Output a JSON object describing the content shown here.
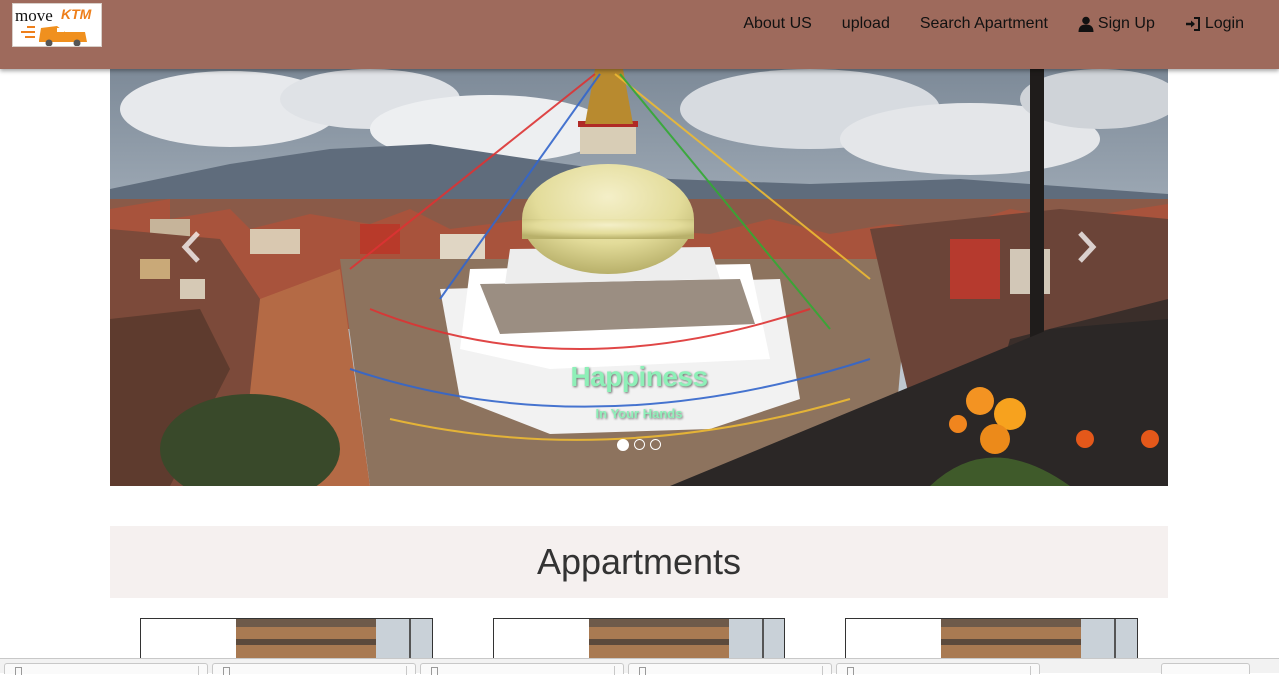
{
  "brand": {
    "logo_text_a": "move",
    "logo_text_b": "KTM"
  },
  "nav": {
    "about": "About US",
    "upload": "upload",
    "search": "Search Apartment",
    "signup": "Sign Up",
    "login": "Login"
  },
  "icons": {
    "signup": "user-icon",
    "login": "login-icon",
    "prev": "chevron-left-icon",
    "next": "chevron-right-icon"
  },
  "carousel": {
    "caption_title": "Happiness",
    "caption_subtitle": "In Your Hands",
    "slide_count": 3,
    "active_slide": 1
  },
  "section": {
    "title": "Appartments"
  },
  "colors": {
    "navbar": "#9e6a5c",
    "caption": "#8ef0b8",
    "section_bg": "#f5f0ef"
  }
}
